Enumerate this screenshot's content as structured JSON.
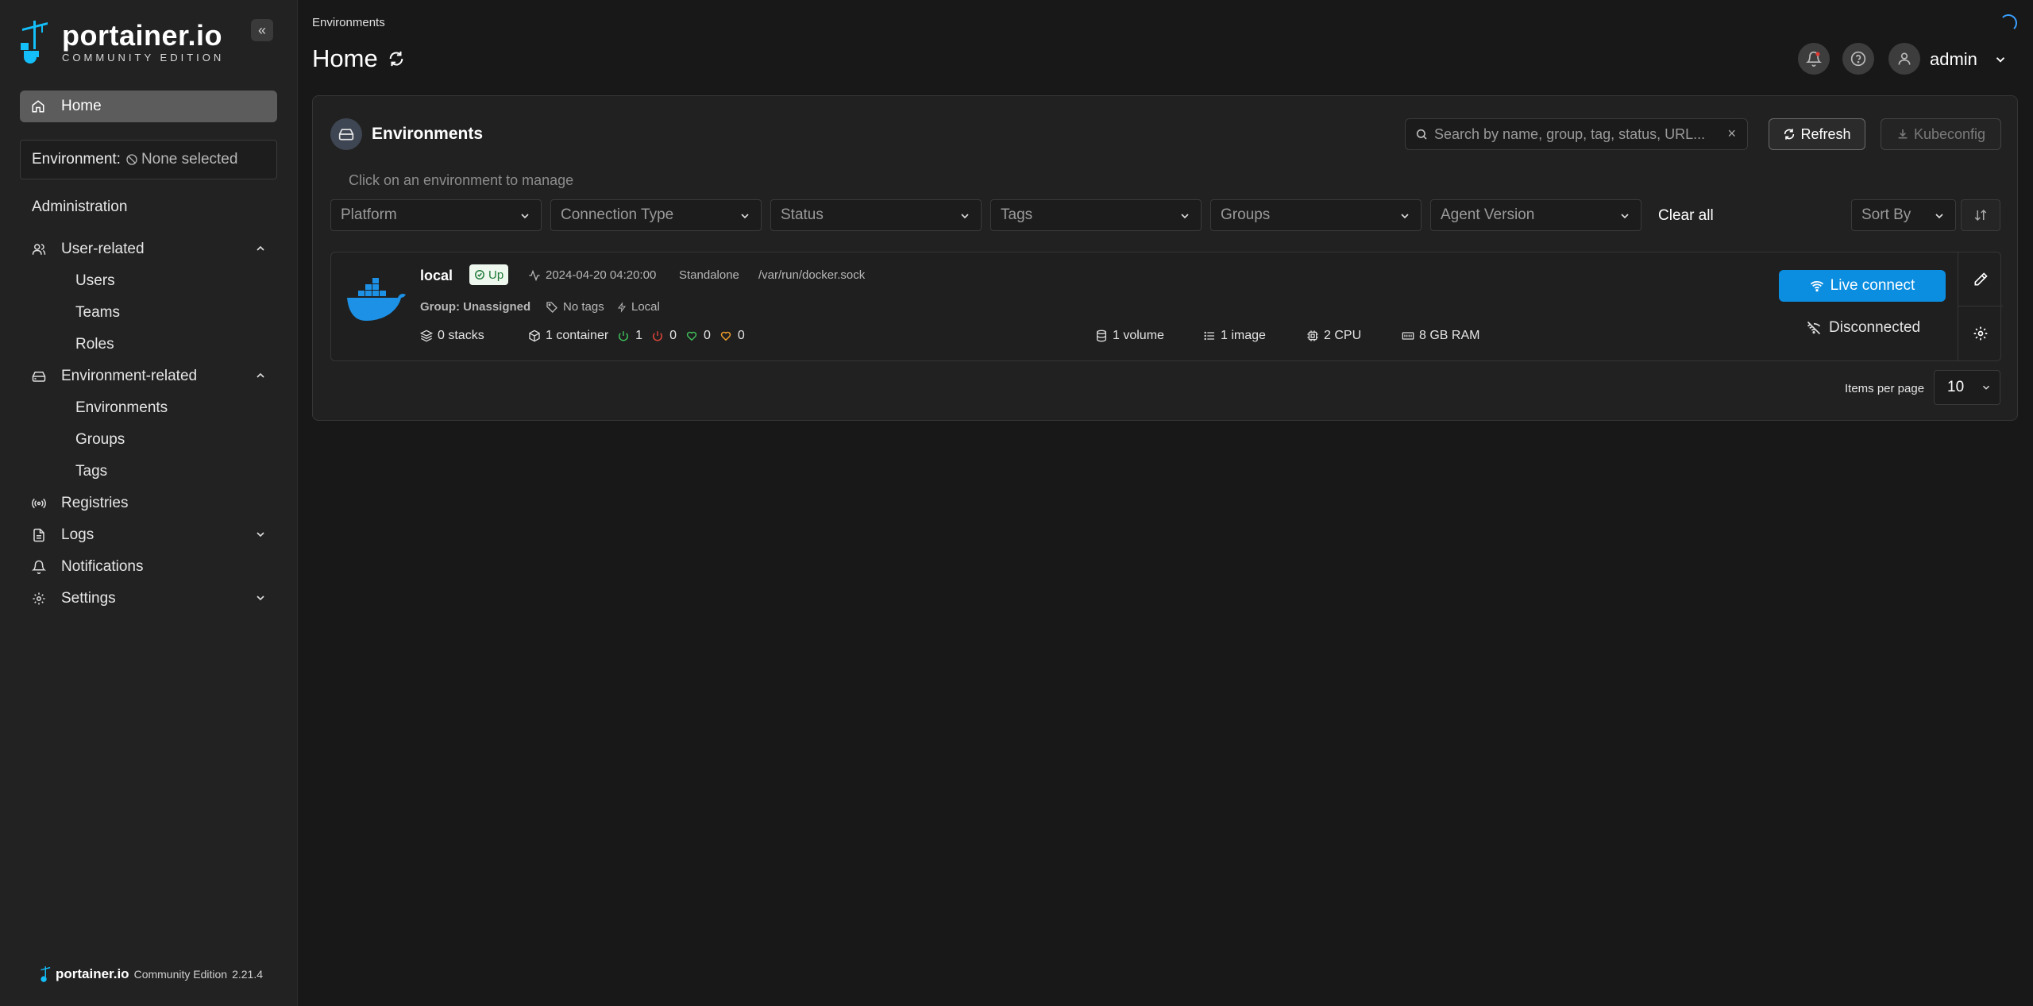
{
  "sidebar": {
    "brand": "portainer.io",
    "edition": "COMMUNITY EDITION",
    "collapse_glyph": "«",
    "home": "Home",
    "environment_label": "Environment:",
    "environment_value": "None selected",
    "administration": "Administration",
    "user_related": "User-related",
    "users": "Users",
    "teams": "Teams",
    "roles": "Roles",
    "environment_related": "Environment-related",
    "environments": "Environments",
    "groups": "Groups",
    "tags": "Tags",
    "registries": "Registries",
    "logs": "Logs",
    "notifications": "Notifications",
    "settings": "Settings",
    "footer_brand": "portainer.io",
    "footer_edition": "Community Edition",
    "footer_version": "2.21.4"
  },
  "header": {
    "breadcrumb": "Environments",
    "title": "Home",
    "username": "admin"
  },
  "panel": {
    "title": "Environments",
    "search_placeholder": "Search by name, group, tag, status, URL...",
    "search_clear": "×",
    "refresh": "Refresh",
    "kubeconfig": "Kubeconfig",
    "hint": "Click on an environment to manage",
    "filters": {
      "platform": "Platform",
      "connection_type": "Connection Type",
      "status": "Status",
      "tags": "Tags",
      "groups": "Groups",
      "agent_version": "Agent Version"
    },
    "clear_all": "Clear all",
    "sort_by": "Sort By",
    "items_per_page_label": "Items per page",
    "items_per_page_value": "10"
  },
  "environment": {
    "name": "local",
    "status": "Up",
    "timestamp": "2024-04-20 04:20:00",
    "type": "Standalone",
    "url": "/var/run/docker.sock",
    "group": "Group: Unassigned",
    "tags": "No tags",
    "location": "Local",
    "stacks": "0 stacks",
    "containers": "1 container",
    "running": "1",
    "stopped": "0",
    "healthy": "0",
    "unhealthy": "0",
    "volumes": "1 volume",
    "images": "1 image",
    "cpu": "2 CPU",
    "ram": "8 GB RAM",
    "live_connect": "Live connect",
    "connection_state": "Disconnected"
  },
  "colors": {
    "accent": "#0b8de0",
    "brand_blue": "#13bef9",
    "status_up_bg": "#eef8ef",
    "status_up_text": "#1f7a37"
  }
}
